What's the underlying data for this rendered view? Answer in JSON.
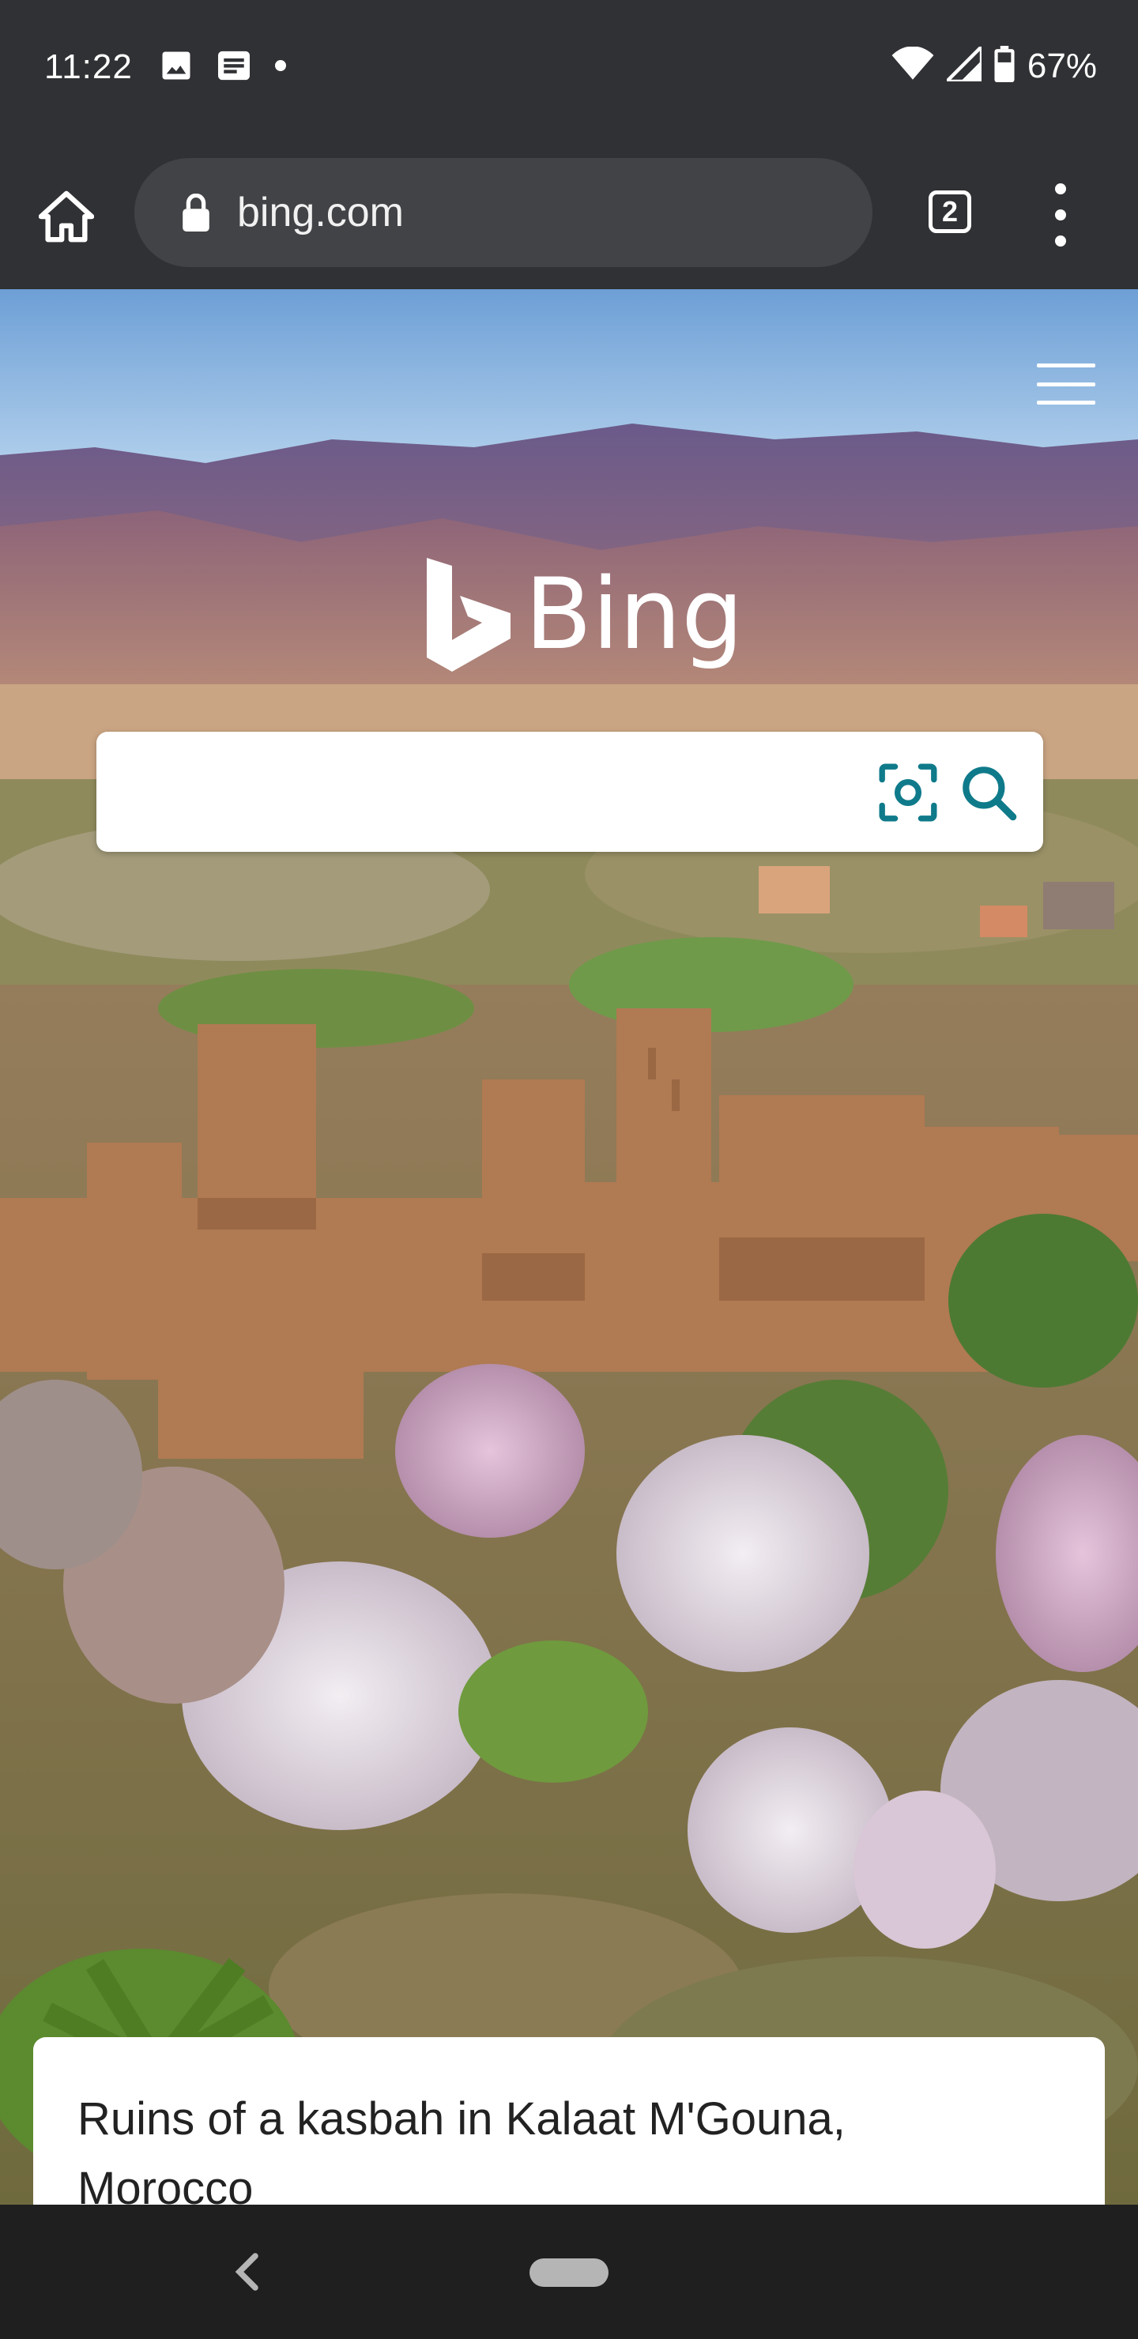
{
  "status_bar": {
    "time": "11:22",
    "battery": "67%"
  },
  "toolbar": {
    "url": "bing.com",
    "tab_count": "2"
  },
  "page": {
    "logo_text": "Bing",
    "search": {
      "value": "",
      "placeholder": ""
    },
    "caption": "Ruins of a kasbah in Kalaat M'Gouna, Morocco"
  },
  "colors": {
    "accent": "#0F7A8A"
  },
  "icons": {
    "status_left": [
      "image-icon",
      "news-icon",
      "dot-icon"
    ],
    "status_right": [
      "wifi-icon",
      "signal-icon",
      "battery-icon"
    ]
  }
}
